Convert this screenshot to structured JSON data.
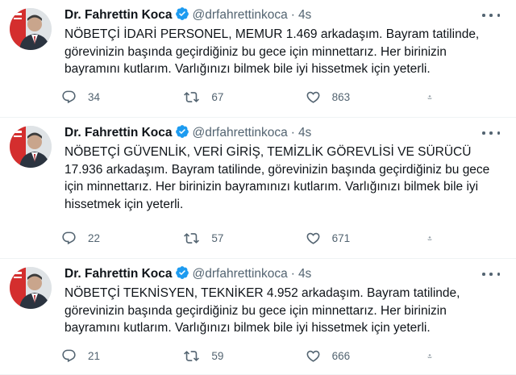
{
  "colors": {
    "text": "#0f1419",
    "secondary": "#536471",
    "verified": "#1d9bf0"
  },
  "tweets": [
    {
      "name": "Dr. Fahrettin Koca",
      "handle": "@drfahrettinkoca",
      "dot": "·",
      "time": "4s",
      "text": "NÖBETÇİ İDARİ PERSONEL, MEMUR 1.469 arkadaşım. Bayram tatilinde,\ngörevinizin başında geçirdiğiniz bu gece için minnettarız. Her birinizin\nbayramını kutlarım. Varlığınızı bilmek bile iyi hissetmek için yeterli.",
      "replies": "34",
      "retweets": "67",
      "likes": "863"
    },
    {
      "name": "Dr. Fahrettin Koca",
      "handle": "@drfahrettinkoca",
      "dot": "·",
      "time": "4s",
      "text": "NÖBETÇİ GÜVENLİK, VERİ GİRİŞ, TEMİZLİK GÖREVLİSİ VE SÜRÜCÜ\n17.936 arkadaşım. Bayram tatilinde, görevinizin başında geçirdiğiniz bu gece\niçin minnettarız. Her birinizin bayramınızı kutlarım. Varlığınızı bilmek bile iyi\nhissetmek için yeterli.",
      "replies": "22",
      "retweets": "57",
      "likes": "671"
    },
    {
      "name": "Dr. Fahrettin Koca",
      "handle": "@drfahrettinkoca",
      "dot": "·",
      "time": "4s",
      "text": "NÖBETÇİ TEKNİSYEN, TEKNİKER 4.952 arkadaşım. Bayram tatilinde,\ngörevinizin başında geçirdiğiniz bu gece için minnettarız. Her birinizin\nbayramını kutlarım. Varlığınızı bilmek bile iyi hissetmek için yeterli.",
      "replies": "21",
      "retweets": "59",
      "likes": "666"
    }
  ]
}
